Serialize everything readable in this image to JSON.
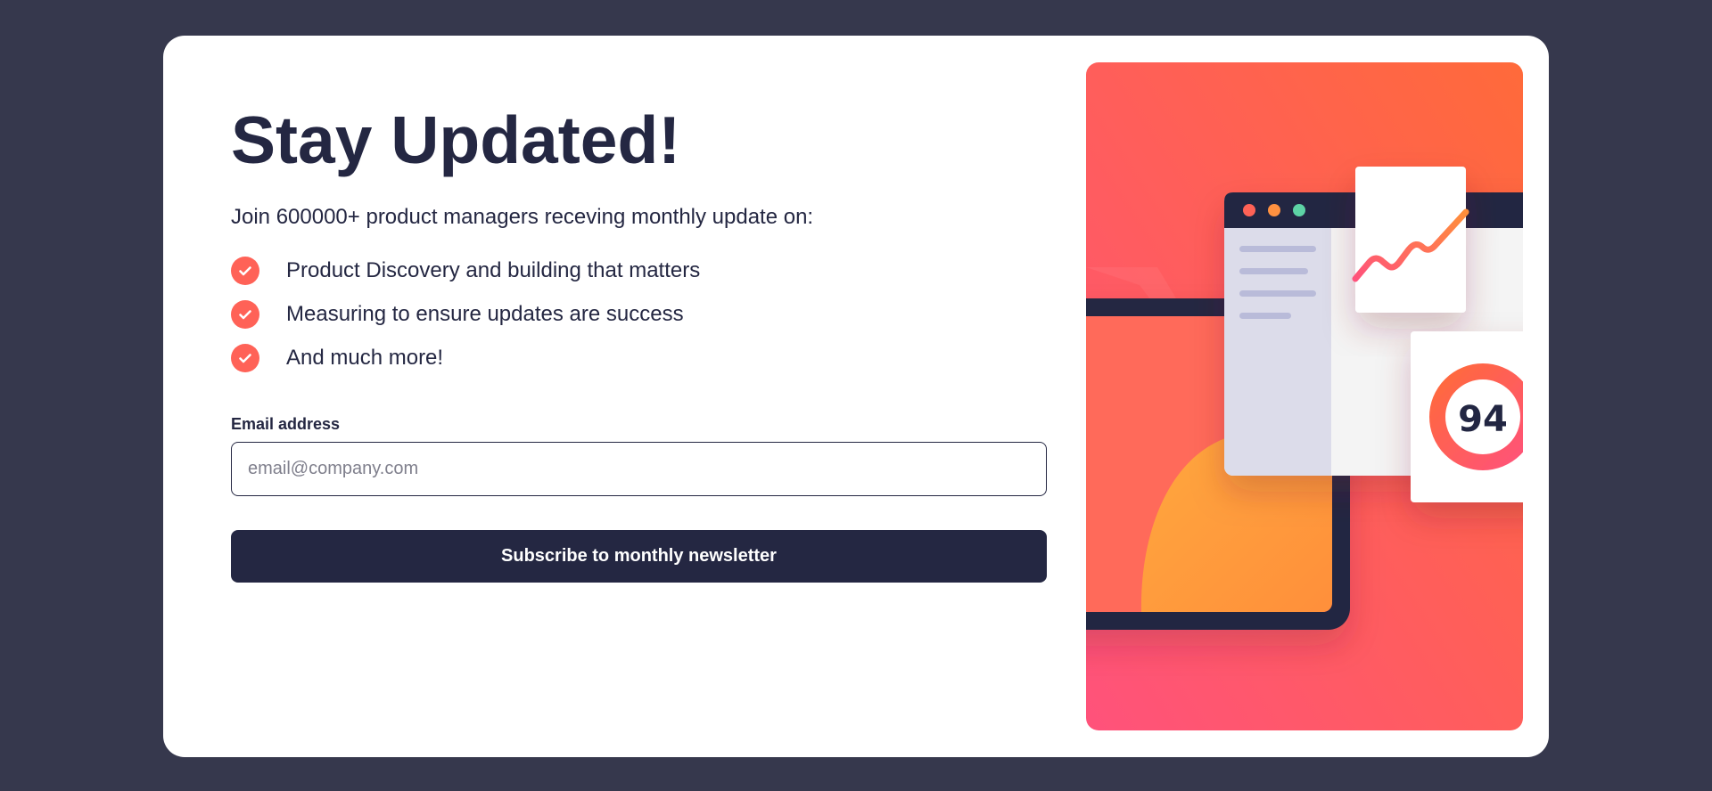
{
  "signup": {
    "title": "Stay Updated!",
    "intro": "Join 600000+ product managers receving monthly update on:",
    "features": [
      {
        "text": "Product Discovery and building that matters"
      },
      {
        "text": "Measuring to ensure updates are success"
      },
      {
        "text": "And much more!"
      }
    ],
    "email_label": "Email address",
    "email_placeholder": "email@company.com",
    "email_value": "",
    "subscribe_label": "Subscribe to monthly newsletter"
  },
  "illustration": {
    "score": "94"
  },
  "colors": {
    "page_background": "#36384d",
    "card_background": "#ffffff",
    "dark_navy": "#242742",
    "tomato": "#ff6257",
    "gradient_orange": "#ff6a3a",
    "gradient_pink": "#ff527b"
  },
  "icons": {
    "feature_check": "check-circle-icon"
  }
}
